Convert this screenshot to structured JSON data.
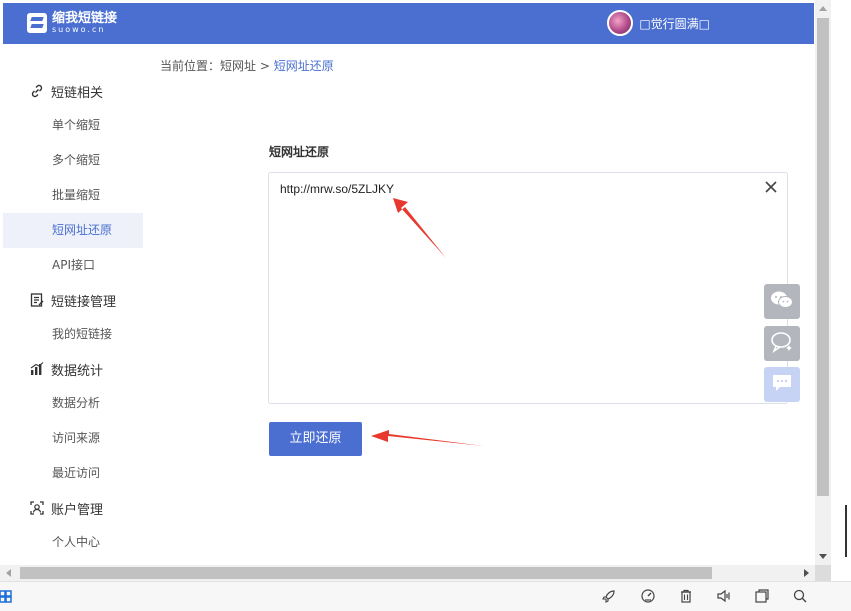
{
  "header": {
    "logo_cn": "缩我短链接",
    "logo_en": "suowo.cn",
    "user_name": "□觉行圆满□",
    "bg_color": "#4a6fd1"
  },
  "breadcrumb": {
    "prefix": "当前位置：",
    "root": "短网址",
    "separator": " > ",
    "current": "短网址还原"
  },
  "sidebar": {
    "groups": [
      {
        "label": "短链相关",
        "icon": "link-icon",
        "items": [
          "单个缩短",
          "多个缩短",
          "批量缩短",
          "短网址还原",
          "API接口"
        ]
      },
      {
        "label": "短链接管理",
        "icon": "edit-document-icon",
        "items": [
          "我的短链接"
        ]
      },
      {
        "label": "数据统计",
        "icon": "bar-chart-icon",
        "items": [
          "数据分析",
          "访问来源",
          "最近访问"
        ]
      },
      {
        "label": "账户管理",
        "icon": "account-icon",
        "items": [
          "个人中心"
        ]
      }
    ],
    "active_item": "短网址还原"
  },
  "main": {
    "section_title": "短网址还原",
    "textarea_value": "http://mrw.so/5ZLJKY",
    "restore_button": "立即还原"
  },
  "float_buttons": [
    "wechat-icon",
    "feedback-icon",
    "chat-icon"
  ]
}
